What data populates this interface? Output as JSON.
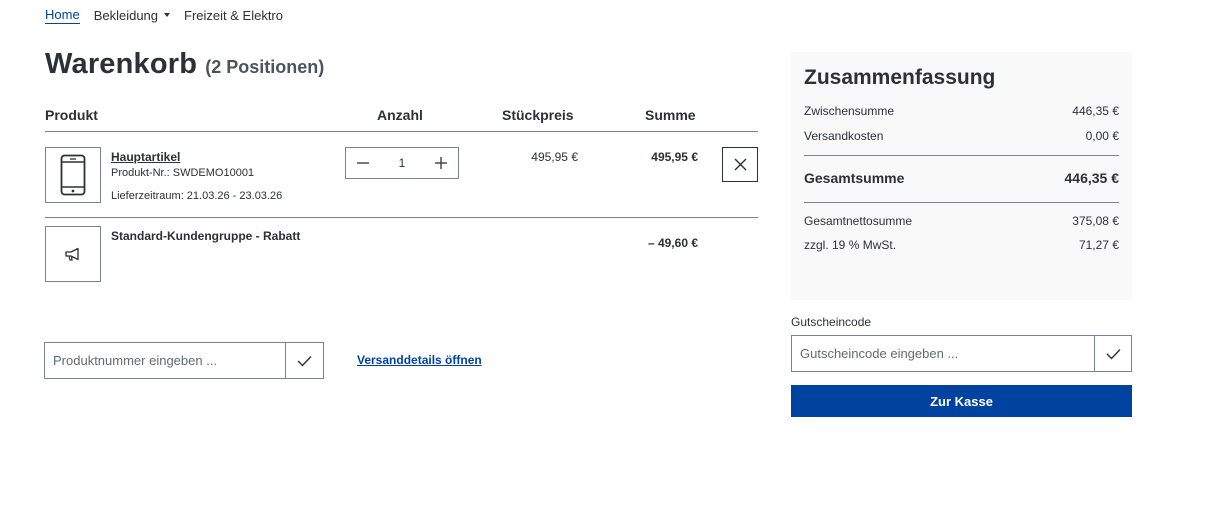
{
  "nav": {
    "items": [
      {
        "label": "Home",
        "active": true
      },
      {
        "label": "Bekleidung",
        "dropdown": true
      },
      {
        "label": "Freizeit & Elektro"
      }
    ]
  },
  "cart": {
    "title": "Warenkorb",
    "count_label": "(2 Positionen)",
    "headers": {
      "product": "Produkt",
      "quantity": "Anzahl",
      "unit_price": "Stückpreis",
      "total": "Summe"
    },
    "items": [
      {
        "icon": "smartphone-icon",
        "name": "Hauptartikel",
        "product_number": "Produkt-Nr.: SWDEMO10001",
        "delivery": "Lieferzeitraum: 21.03.26 - 23.03.26",
        "quantity": "1",
        "unit_price": "495,95 €",
        "total": "495,95 €"
      },
      {
        "icon": "megaphone-icon",
        "name": "Standard-Kundengruppe - Rabatt",
        "total": "– 49,60 €"
      }
    ],
    "add_product_placeholder": "Produktnummer eingeben ...",
    "shipping_link": "Versanddetails öffnen"
  },
  "summary": {
    "title": "Zusammenfassung",
    "subtotal_label": "Zwischensumme",
    "subtotal_value": "446,35 €",
    "shipping_label": "Versandkosten",
    "shipping_value": "0,00 €",
    "total_label": "Gesamtsumme",
    "total_value": "446,35 €",
    "net_label": "Gesamtnettosumme",
    "net_value": "375,08 €",
    "tax_label": "zzgl. 19 % MwSt.",
    "tax_value": "71,27 €"
  },
  "voucher": {
    "label": "Gutscheincode",
    "placeholder": "Gutscheincode eingeben ..."
  },
  "checkout_label": "Zur Kasse",
  "colors": {
    "accent": "#0042a0",
    "text": "#2b3136",
    "border": "#798490",
    "summary_bg": "#f9f9f9"
  }
}
